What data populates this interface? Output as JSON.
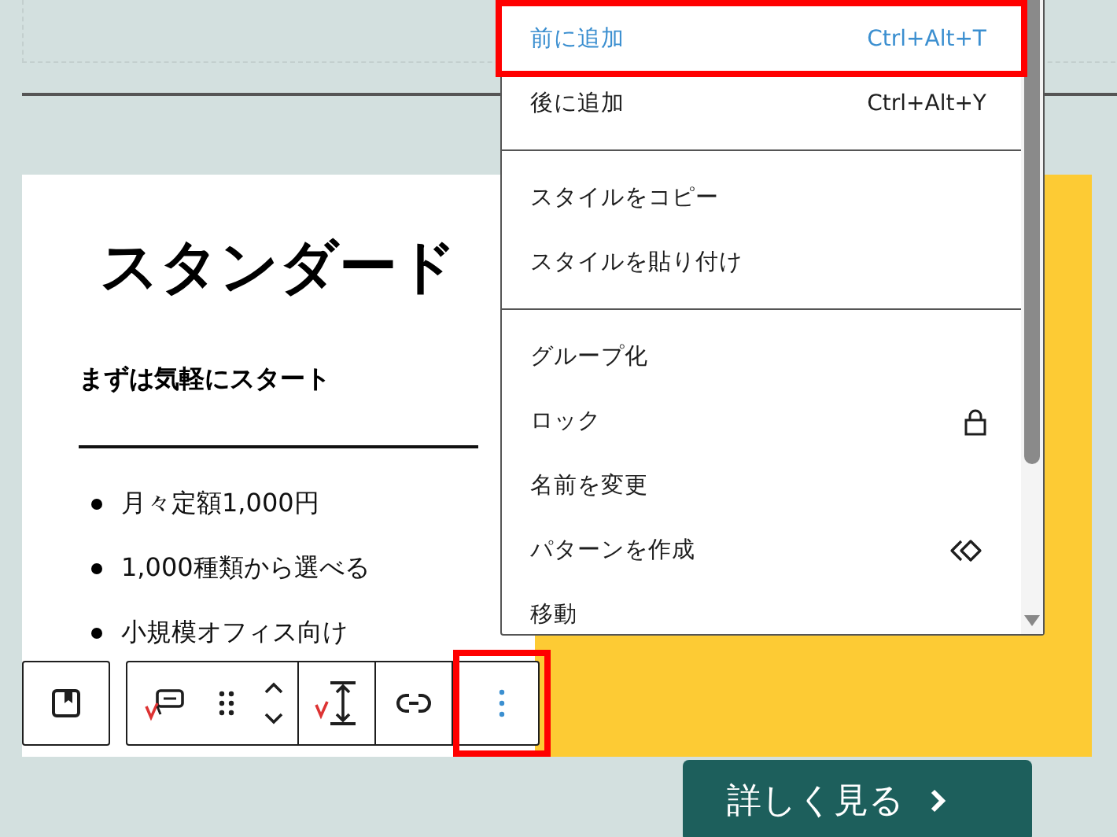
{
  "plan_card": {
    "title": "スタンダード",
    "subtitle": "まずは気軽にスタート",
    "features": [
      "月々定額1,000円",
      "1,000種類から選べる",
      "小規模オフィス向け"
    ]
  },
  "toolbar": {
    "groups": [
      {
        "buttons": [
          {
            "kind": "block-type",
            "highlighted": false
          }
        ]
      },
      {
        "buttons": [
          {
            "kind": "transform",
            "highlighted": false
          },
          {
            "kind": "drag",
            "highlighted": false
          },
          {
            "kind": "move",
            "highlighted": false
          }
        ]
      },
      {
        "buttons": [
          {
            "kind": "spacing",
            "highlighted": false
          }
        ]
      },
      {
        "buttons": [
          {
            "kind": "link",
            "highlighted": false
          }
        ]
      },
      {
        "buttons": [
          {
            "kind": "more",
            "highlighted": true
          }
        ]
      }
    ]
  },
  "context_menu": {
    "sections": [
      {
        "items": [
          {
            "kind": "shortcut",
            "label": "前に追加",
            "shortcut": "Ctrl+Alt+T",
            "selected": true
          },
          {
            "kind": "shortcut",
            "label": "後に追加",
            "shortcut": "Ctrl+Alt+Y",
            "selected": false
          }
        ]
      },
      {
        "items": [
          {
            "kind": "plain",
            "label": "スタイルをコピー",
            "selected": false
          },
          {
            "kind": "plain",
            "label": "スタイルを貼り付け",
            "selected": false
          }
        ]
      },
      {
        "items": [
          {
            "kind": "plain",
            "label": "グループ化",
            "selected": false
          },
          {
            "kind": "lock",
            "label": "ロック",
            "selected": false
          },
          {
            "kind": "plain",
            "label": "名前を変更",
            "selected": false
          },
          {
            "kind": "pattern",
            "label": "パターンを作成",
            "selected": false
          },
          {
            "kind": "plain",
            "label": "移動",
            "selected": false
          }
        ]
      }
    ]
  },
  "cta_button": {
    "label": "詳しく見る"
  }
}
